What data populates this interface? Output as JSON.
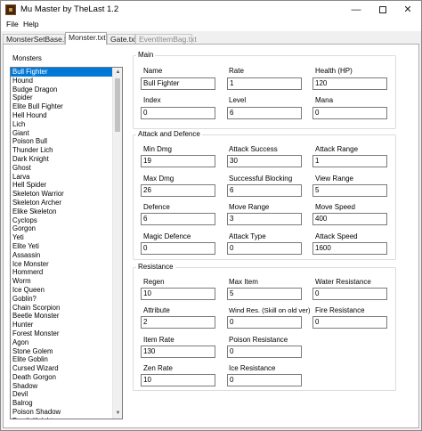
{
  "window": {
    "title": "Mu Master by TheLast 1.2",
    "controls": {
      "minimize": "—",
      "close": "✕"
    }
  },
  "menu": [
    "File",
    "Help"
  ],
  "tabs": [
    {
      "label": "MonsterSetBase.txt",
      "state": "inactive"
    },
    {
      "label": "Monster.txt",
      "state": "active"
    },
    {
      "label": "Gate.txt",
      "state": "inactive"
    },
    {
      "label": "EventItemBag.txt",
      "state": "disabled"
    }
  ],
  "monsters": {
    "label": "Monsters",
    "selected_index": 0,
    "items": [
      "Bull Fighter",
      "Hound",
      "Budge Dragon",
      "Spider",
      "Elite Bull Fighter",
      "Hell Hound",
      "Lich",
      "Giant",
      "Poison Bull",
      "Thunder Lich",
      "Dark Knight",
      "Ghost",
      "Larva",
      "Hell Spider",
      "Skeleton Warrior",
      "Skeleton Archer",
      "Elike Skeleton",
      "Cyclops",
      "Gorgon",
      "Yeti",
      "Elite Yeti",
      "Assassin",
      "Ice Monster",
      "Hommerd",
      "Worm",
      "Ice Queen",
      "Goblin?",
      "Chain Scorpion",
      "Beetle Monster",
      "Hunter",
      "Forest Monster",
      "Agon",
      "Stone Golem",
      "Elite Goblin",
      "Cursed Wizard",
      "Death Gorgon",
      "Shadow",
      "Devil",
      "Balrog",
      "Poison Shadow",
      "Death Knight"
    ]
  },
  "main": {
    "title": "Main",
    "name": {
      "label": "Name",
      "value": "Bull Fighter"
    },
    "rate": {
      "label": "Rate",
      "value": "1"
    },
    "health": {
      "label": "Health (HP)",
      "value": "120"
    },
    "index": {
      "label": "Index",
      "value": "0"
    },
    "level": {
      "label": "Level",
      "value": "6"
    },
    "mana": {
      "label": "Mana",
      "value": "0"
    }
  },
  "attack": {
    "title": "Attack and Defence",
    "min_dmg": {
      "label": "Min Dmg",
      "value": "19"
    },
    "attack_success": {
      "label": "Attack Success",
      "value": "30"
    },
    "attack_range": {
      "label": "Attack Range",
      "value": "1"
    },
    "max_dmg": {
      "label": "Max Dmg",
      "value": "26"
    },
    "successful_blocking": {
      "label": "Successful Blocking",
      "value": "6"
    },
    "view_range": {
      "label": "View Range",
      "value": "5"
    },
    "defence": {
      "label": "Defence",
      "value": "6"
    },
    "move_range": {
      "label": "Move Range",
      "value": "3"
    },
    "move_speed": {
      "label": "Move Speed",
      "value": "400"
    },
    "magic_defence": {
      "label": "Magic Defence",
      "value": "0"
    },
    "attack_type": {
      "label": "Attack Type",
      "value": "0"
    },
    "attack_speed": {
      "label": "Attack Speed",
      "value": "1600"
    }
  },
  "resistance": {
    "title": "Resistance",
    "regen": {
      "label": "Regen",
      "value": "10"
    },
    "max_item": {
      "label": "Max Item",
      "value": "5"
    },
    "water_resistance": {
      "label": "Water Resistance",
      "value": "0"
    },
    "attribute": {
      "label": "Attribute",
      "value": "2"
    },
    "wind_res": {
      "label": "Wind Res. (Skill on old ver)",
      "value": "0"
    },
    "fire_resistance": {
      "label": "Fire Resistance",
      "value": "0"
    },
    "item_rate": {
      "label": "Item Rate",
      "value": "130"
    },
    "poison_resistance": {
      "label": "Poison Resistance",
      "value": "0"
    },
    "zen_rate": {
      "label": "Zen Rate",
      "value": "10"
    },
    "ice_resistance": {
      "label": "Ice Resistance",
      "value": "0"
    }
  },
  "colors": {
    "selection": "#0078d7",
    "window_bg": "#f0f0f0",
    "panel_bg": "#ffffff",
    "group_border": "#dcdcdc"
  },
  "icons": [
    "app-icon",
    "minimize-icon",
    "maximize-icon",
    "close-icon",
    "scroll-up-arrow-icon",
    "scroll-down-arrow-icon"
  ]
}
